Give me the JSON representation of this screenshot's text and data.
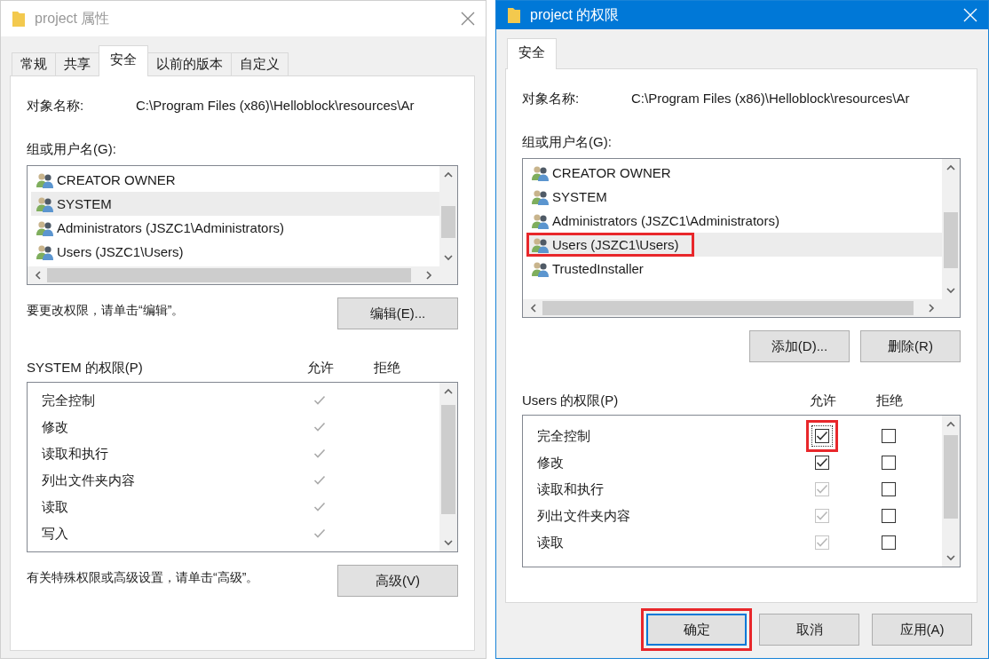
{
  "windows": [
    {
      "title": "project 属性",
      "active": false,
      "tabs": [
        {
          "label": "常规",
          "selected": false
        },
        {
          "label": "共享",
          "selected": false
        },
        {
          "label": "安全",
          "selected": true
        },
        {
          "label": "以前的版本",
          "selected": false
        },
        {
          "label": "自定义",
          "selected": false
        }
      ],
      "object_label": "对象名称:",
      "object_path": "C:\\Program Files (x86)\\Helloblock\\resources\\Ar",
      "groups_label": "组或用户名(G):",
      "groups": [
        {
          "name": "CREATOR OWNER",
          "selected": false,
          "highlighted": false
        },
        {
          "name": "SYSTEM",
          "selected": true,
          "highlighted": false
        },
        {
          "name": "Administrators (JSZC1\\Administrators)",
          "selected": false,
          "highlighted": false
        },
        {
          "name": "Users (JSZC1\\Users)",
          "selected": false,
          "highlighted": false
        }
      ],
      "group_note": "要更改权限，请单击“编辑”。",
      "group_buttons": [
        "编辑(E)..."
      ],
      "permissions": {
        "title": "SYSTEM 的权限(P)",
        "allow_header": "允许",
        "deny_header": "拒绝",
        "kind": "readonly",
        "rows": [
          {
            "name": "完全控制",
            "allow": true,
            "deny": false
          },
          {
            "name": "修改",
            "allow": true,
            "deny": false
          },
          {
            "name": "读取和执行",
            "allow": true,
            "deny": false
          },
          {
            "name": "列出文件夹内容",
            "allow": true,
            "deny": false
          },
          {
            "name": "读取",
            "allow": true,
            "deny": false
          },
          {
            "name": "写入",
            "allow": true,
            "deny": false
          }
        ]
      },
      "advanced_note": "有关特殊权限或高级设置，请单击“高级”。",
      "advanced_button": "高级(V)"
    },
    {
      "title": "project 的权限",
      "active": true,
      "tabs": [
        {
          "label": "安全",
          "selected": true
        }
      ],
      "object_label": "对象名称:",
      "object_path": "C:\\Program Files (x86)\\Helloblock\\resources\\Ar",
      "groups_label": "组或用户名(G):",
      "groups": [
        {
          "name": "CREATOR OWNER",
          "selected": false,
          "highlighted": false
        },
        {
          "name": "SYSTEM",
          "selected": false,
          "highlighted": false
        },
        {
          "name": "Administrators (JSZC1\\Administrators)",
          "selected": false,
          "highlighted": false
        },
        {
          "name": "Users (JSZC1\\Users)",
          "selected": true,
          "highlighted": true
        },
        {
          "name": "TrustedInstaller",
          "selected": false,
          "highlighted": false
        }
      ],
      "group_buttons": [
        "添加(D)...",
        "删除(R)"
      ],
      "permissions": {
        "title": "Users 的权限(P)",
        "allow_header": "允许",
        "deny_header": "拒绝",
        "kind": "checkbox",
        "rows": [
          {
            "name": "完全控制",
            "allow": true,
            "deny": false,
            "disabled": false,
            "focused": true,
            "highlighted": true
          },
          {
            "name": "修改",
            "allow": true,
            "deny": false,
            "disabled": false,
            "focused": false,
            "highlighted": false
          },
          {
            "name": "读取和执行",
            "allow": true,
            "deny": false,
            "disabled": true,
            "focused": false,
            "highlighted": false
          },
          {
            "name": "列出文件夹内容",
            "allow": true,
            "deny": false,
            "disabled": true,
            "focused": false,
            "highlighted": false
          },
          {
            "name": "读取",
            "allow": true,
            "deny": false,
            "disabled": true,
            "focused": false,
            "highlighted": false
          }
        ]
      },
      "footer_buttons": [
        {
          "label": "确定",
          "default": true,
          "highlighted": true
        },
        {
          "label": "取消",
          "default": false,
          "highlighted": false
        },
        {
          "label": "应用(A)",
          "default": false,
          "highlighted": false
        }
      ]
    }
  ]
}
